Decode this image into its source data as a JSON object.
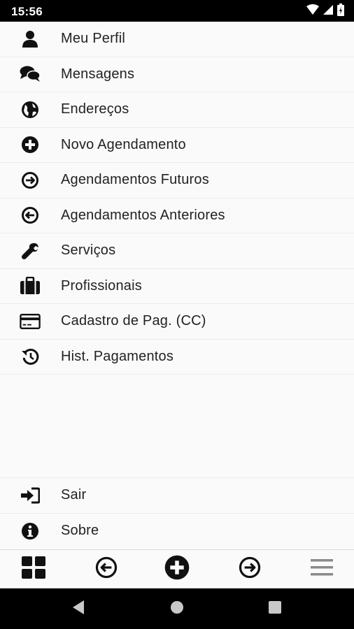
{
  "status": {
    "time": "15:56"
  },
  "menu": {
    "items": [
      {
        "label": "Meu Perfil",
        "icon": "user-icon"
      },
      {
        "label": "Mensagens",
        "icon": "comments-icon"
      },
      {
        "label": "Endereços",
        "icon": "globe-icon"
      },
      {
        "label": "Novo Agendamento",
        "icon": "plus-circle-icon"
      },
      {
        "label": "Agendamentos Futuros",
        "icon": "arrow-right-circle-icon"
      },
      {
        "label": "Agendamentos Anteriores",
        "icon": "arrow-left-circle-icon"
      },
      {
        "label": "Serviços",
        "icon": "wrench-icon"
      },
      {
        "label": "Profissionais",
        "icon": "briefcase-icon"
      },
      {
        "label": "Cadastro de Pag. (CC)",
        "icon": "credit-card-icon"
      },
      {
        "label": "Hist. Pagamentos",
        "icon": "history-icon"
      }
    ],
    "bottom": [
      {
        "label": "Sair",
        "icon": "sign-in-icon"
      },
      {
        "label": "Sobre",
        "icon": "info-circle-icon"
      }
    ]
  },
  "tabbar": {
    "icons": [
      "grid-icon",
      "arrow-left-circle-icon",
      "plus-circle-icon",
      "arrow-right-circle-icon",
      "hamburger-menu-icon"
    ]
  },
  "colors": {
    "status_bar": "#000000",
    "background": "#fafafa",
    "icon": "#111111",
    "text": "#222222"
  }
}
